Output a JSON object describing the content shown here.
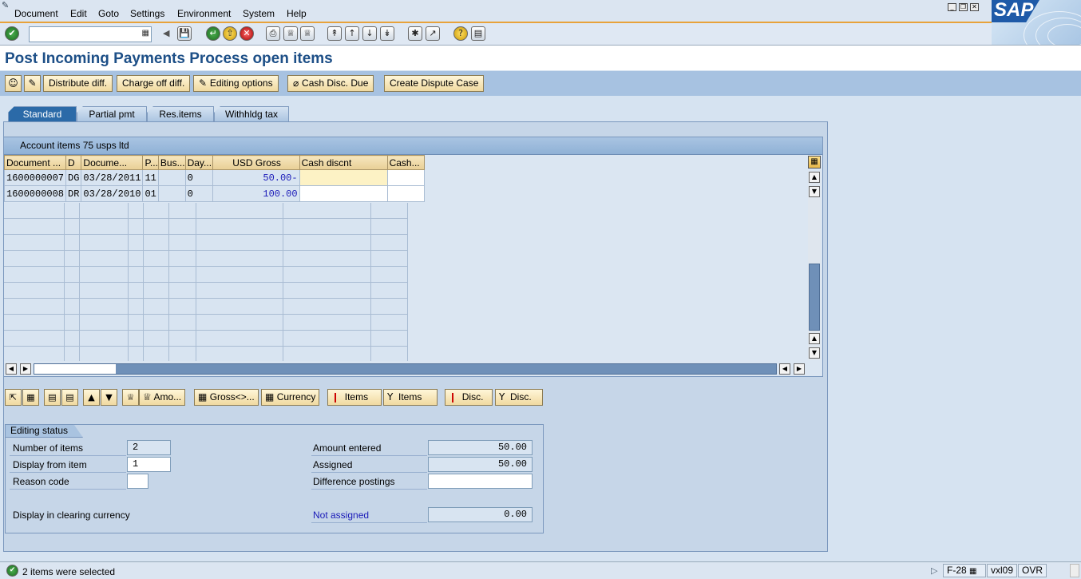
{
  "menu": [
    "Document",
    "Edit",
    "Goto",
    "Settings",
    "Environment",
    "System",
    "Help"
  ],
  "logo": "SAP",
  "command_field": {
    "value": ""
  },
  "page_title": "Post Incoming Payments Process open items",
  "app_toolbar": {
    "distribute_diff": "Distribute diff.",
    "charge_off_diff": "Charge off diff.",
    "editing_options": "Editing options",
    "cash_disc_due": "Cash Disc. Due",
    "create_dispute_case": "Create Dispute Case"
  },
  "tabs": [
    "Standard",
    "Partial pmt",
    "Res.items",
    "Withhldg tax"
  ],
  "active_tab": "Standard",
  "table": {
    "title": "Account items 75 usps ltd",
    "columns": [
      "Document ...",
      "D",
      "Docume...",
      "P...",
      "Bus...",
      "Day...",
      "USD Gross",
      "Cash discnt",
      "Cash..."
    ],
    "rows": [
      [
        "1600000007",
        "DG",
        "03/28/2011",
        "11",
        "",
        "0",
        "50.00-",
        "",
        ""
      ],
      [
        "1600000008",
        "DR",
        "03/28/2010",
        "01",
        "",
        "0",
        "100.00",
        "",
        ""
      ]
    ]
  },
  "lower_toolbar": {
    "amount": "Amo...",
    "gross": "Gross<>...",
    "currency": "Currency",
    "items_1": "Items",
    "items_2": "Items",
    "disc_1": "Disc.",
    "disc_2": "Disc."
  },
  "editing_status": {
    "title": "Editing status",
    "number_of_items_label": "Number of items",
    "number_of_items": "2",
    "display_from_item_label": "Display from item",
    "display_from_item": "1",
    "reason_code_label": "Reason code",
    "reason_code": "",
    "display_clearing_currency": "Display in clearing currency",
    "amount_entered_label": "Amount entered",
    "amount_entered": "50.00",
    "assigned_label": "Assigned",
    "assigned": "50.00",
    "difference_postings_label": "Difference postings",
    "difference_postings": "",
    "not_assigned_label": "Not assigned",
    "not_assigned": "0.00"
  },
  "status_bar": {
    "message": "2 items were selected",
    "transaction": "F-28",
    "server": "vxl09",
    "mode": "OVR"
  }
}
